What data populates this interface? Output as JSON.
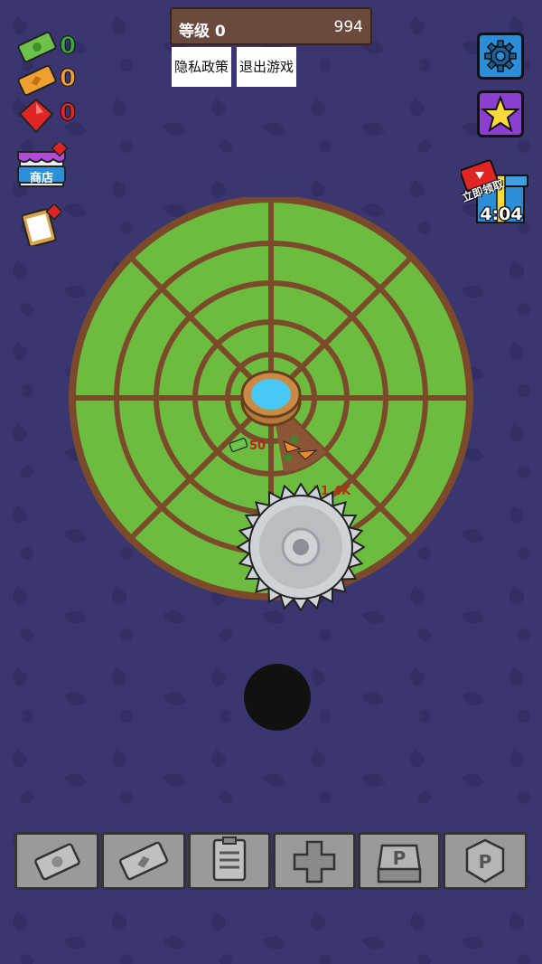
{
  "hud": {
    "level_label": "等级 0",
    "xp_value": "994",
    "privacy_label": "隐私政策",
    "exit_label": "退出游戏"
  },
  "currencies": {
    "cash": "0",
    "tickets": "0",
    "gems": "0"
  },
  "shop": {
    "label": "商店"
  },
  "gift": {
    "claim_label": "立即领取",
    "timer": "4:04"
  },
  "field": {
    "cash_popup": "50",
    "saw_hp": "11.4K"
  },
  "colors": {
    "background": "#3b3670",
    "grass": "#6dbb3f",
    "dirt": "#7a4a2a",
    "cash_green": "#28a745",
    "ticket_orange": "#e8902a",
    "gem_red": "#d92020",
    "settings_blue": "#2a8fd8",
    "star_purple": "#8a3fcf"
  },
  "icons": {
    "settings": "gear-icon",
    "favorite": "star-icon",
    "bottom_slots": [
      "cash-icon",
      "ticket-icon",
      "clipboard-icon",
      "plus-icon",
      "p-chest-icon",
      "p-coin-icon"
    ]
  }
}
